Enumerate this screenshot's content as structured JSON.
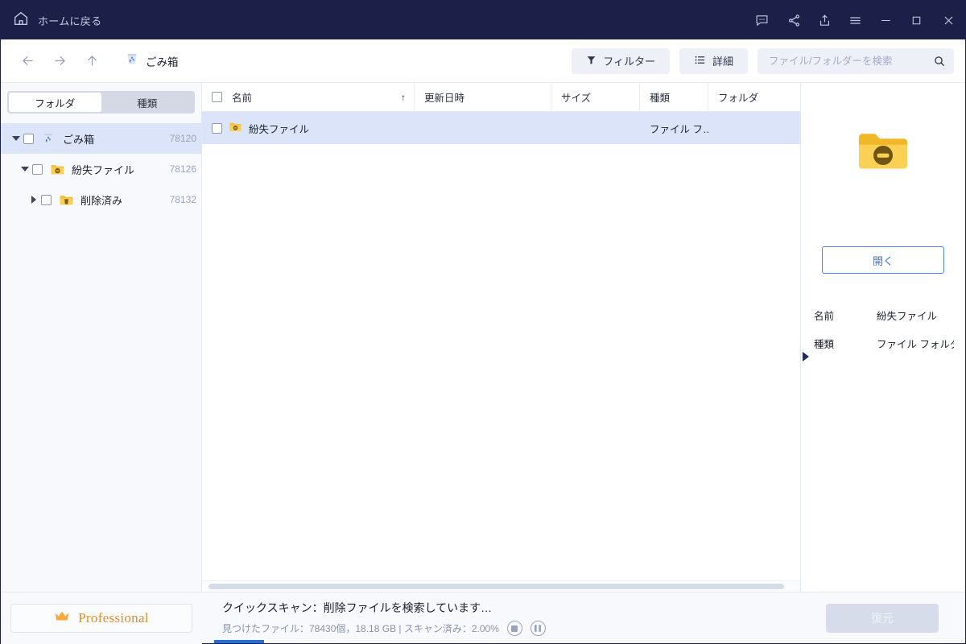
{
  "titlebar": {
    "home_label": "ホームに戻る",
    "icons": [
      {
        "name": "feedback-icon",
        "label": "フィードバック"
      },
      {
        "name": "share-icon",
        "label": "共有"
      },
      {
        "name": "export-icon",
        "label": "エクスポート"
      },
      {
        "name": "menu-icon",
        "label": "メニュー"
      },
      {
        "name": "minimize-icon",
        "label": "最小化"
      },
      {
        "name": "maximize-icon",
        "label": "最大化"
      },
      {
        "name": "close-icon",
        "label": "閉じる"
      }
    ],
    "bg_color": "#1c2048"
  },
  "toolbar": {
    "back_label": "戻る",
    "forward_label": "進む",
    "up_label": "上へ",
    "breadcrumb": "ごみ箱",
    "filter_label": "フィルター",
    "detail_label": "詳細",
    "search_placeholder": "ファイル/フォルダーを検索",
    "search_value": ""
  },
  "sidebar": {
    "tabs": [
      {
        "label": "フォルダ",
        "active": true
      },
      {
        "label": "種類",
        "active": false
      }
    ],
    "tree": [
      {
        "label": "ごみ箱",
        "count": "78120",
        "icon": "recycle-bin-icon",
        "depth": 0,
        "expanded": true,
        "selected": true
      },
      {
        "label": "紛失ファイル",
        "count": "78126",
        "icon": "lost-folder-icon",
        "depth": 1,
        "expanded": true,
        "selected": false
      },
      {
        "label": "削除済み",
        "count": "78132",
        "icon": "deleted-folder-icon",
        "depth": 2,
        "expanded": false,
        "selected": false
      }
    ],
    "pro_label": "Professional",
    "pro_color": "#f08a24"
  },
  "filelist": {
    "columns": [
      {
        "label": "名前",
        "sort": "↑"
      },
      {
        "label": "更新日時",
        "sort": ""
      },
      {
        "label": "サイズ",
        "sort": ""
      },
      {
        "label": "種類",
        "sort": ""
      },
      {
        "label": "フォルダ",
        "sort": ""
      }
    ],
    "rows": [
      {
        "name": "紛失ファイル",
        "modified": "",
        "size": "",
        "type": "ファイル フ…",
        "folder": "",
        "icon": "lost-folder-icon",
        "selected": true,
        "checked": false
      }
    ]
  },
  "preview": {
    "icon": "lost-folder-icon",
    "open_label": "開く",
    "fields": [
      {
        "key": "名前",
        "value": "紛失ファイル"
      },
      {
        "key": "種類",
        "value": "ファイル フォルダー"
      }
    ]
  },
  "footer": {
    "scan_title": "クイックスキャン：削除ファイルを検索しています…",
    "scan_detail": "見つけたファイル：78430個，18.18 GB | スキャン済み：2.00%",
    "stop_label": "停止",
    "pause_label": "一時停止",
    "restore_label": "復元",
    "restore_enabled": false,
    "progress_percent": 2.0,
    "accent_color": "#1f6fe0"
  }
}
